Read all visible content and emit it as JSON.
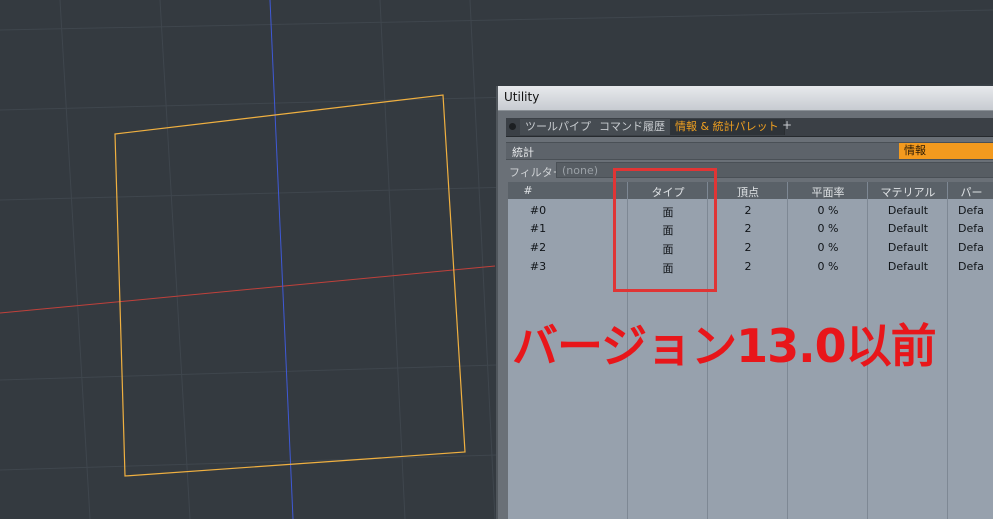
{
  "window": {
    "title": "Utility"
  },
  "tabs": [
    {
      "label": "ツールパイプ",
      "active": false
    },
    {
      "label": "コマンド履歴",
      "active": false
    },
    {
      "label": "情報 & 統計パレット",
      "active": true
    }
  ],
  "add_tab_label": "+",
  "subbar": {
    "stats_label": "統計",
    "info_label": "情報"
  },
  "filter": {
    "label": "フィルター",
    "value": "(none)"
  },
  "table": {
    "headers": [
      "#",
      "タイプ",
      "頂点",
      "平面率",
      "マテリアル",
      "パー"
    ],
    "rows": [
      [
        "#0",
        "面",
        "2",
        "0 %",
        "Default",
        "Defa"
      ],
      [
        "#1",
        "面",
        "2",
        "0 %",
        "Default",
        "Defa"
      ],
      [
        "#2",
        "面",
        "2",
        "0 %",
        "Default",
        "Defa"
      ],
      [
        "#3",
        "面",
        "2",
        "0 %",
        "Default",
        "Defa"
      ]
    ]
  },
  "annotation": {
    "text": "バージョン13.0以前",
    "color": "#e8161a"
  },
  "colors": {
    "accent": "#f39a1e",
    "viewport_bg": "#343a40",
    "selection": "#f0b040"
  }
}
